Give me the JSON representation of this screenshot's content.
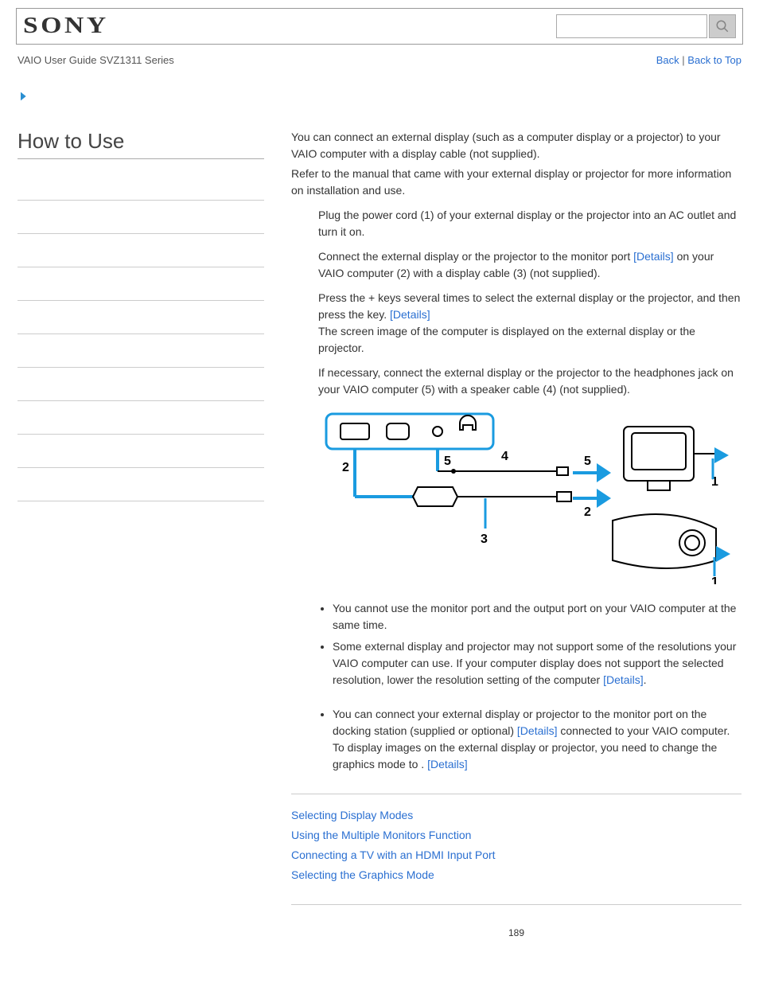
{
  "header": {
    "logo": "SONY",
    "guide": "VAIO User Guide SVZ1311 Series",
    "back": "Back",
    "back_to_top": "Back to Top"
  },
  "sidebar": {
    "title": "How to Use"
  },
  "content": {
    "intro1": "You can connect an external display (such as a computer display or a projector) to your VAIO computer with a display cable (not supplied).",
    "intro2": "Refer to the manual that came with your external display or projector for more information on installation and use.",
    "step1": "Plug the power cord (1) of your external display or the projector into an AC outlet and turn it on.",
    "step2a": "Connect the external display or the projector to the monitor port ",
    "step2b": " on your VAIO computer (2) with a display cable (3) (not supplied).",
    "step3a": "Press the ",
    "step3b": " + ",
    "step3c": " keys several times to select the external display or the projector, and then press the ",
    "step3d": " key. ",
    "step3e": "The screen image of the computer is displayed on the external display or the projector.",
    "step4": "If necessary, connect the external display or the projector to the headphones jack on your VAIO computer (5) with a speaker cable (4) (not supplied).",
    "details": "[Details]",
    "note1a": "You cannot use the monitor port and the ",
    "note1b": " output port on your VAIO computer at the same time.",
    "note2a": "Some external display and projector may not support some of the resolutions your VAIO computer can use. If your computer display does not support the selected resolution, lower the resolution setting of the computer ",
    "note2b": ".",
    "note3a": "You can connect your external display or projector to the monitor port on the docking station (supplied or optional) ",
    "note3b": " connected to your VAIO computer. To display images on the external display or projector, you need to change the graphics mode to ",
    "note3c": ". "
  },
  "related": {
    "link1": "Selecting Display Modes",
    "link2": "Using the Multiple Monitors Function",
    "link3": "Connecting a TV with an HDMI Input Port",
    "link4": "Selecting the Graphics Mode"
  },
  "page": "189",
  "diagram": {
    "labels": [
      "1",
      "2",
      "3",
      "4",
      "5"
    ]
  }
}
